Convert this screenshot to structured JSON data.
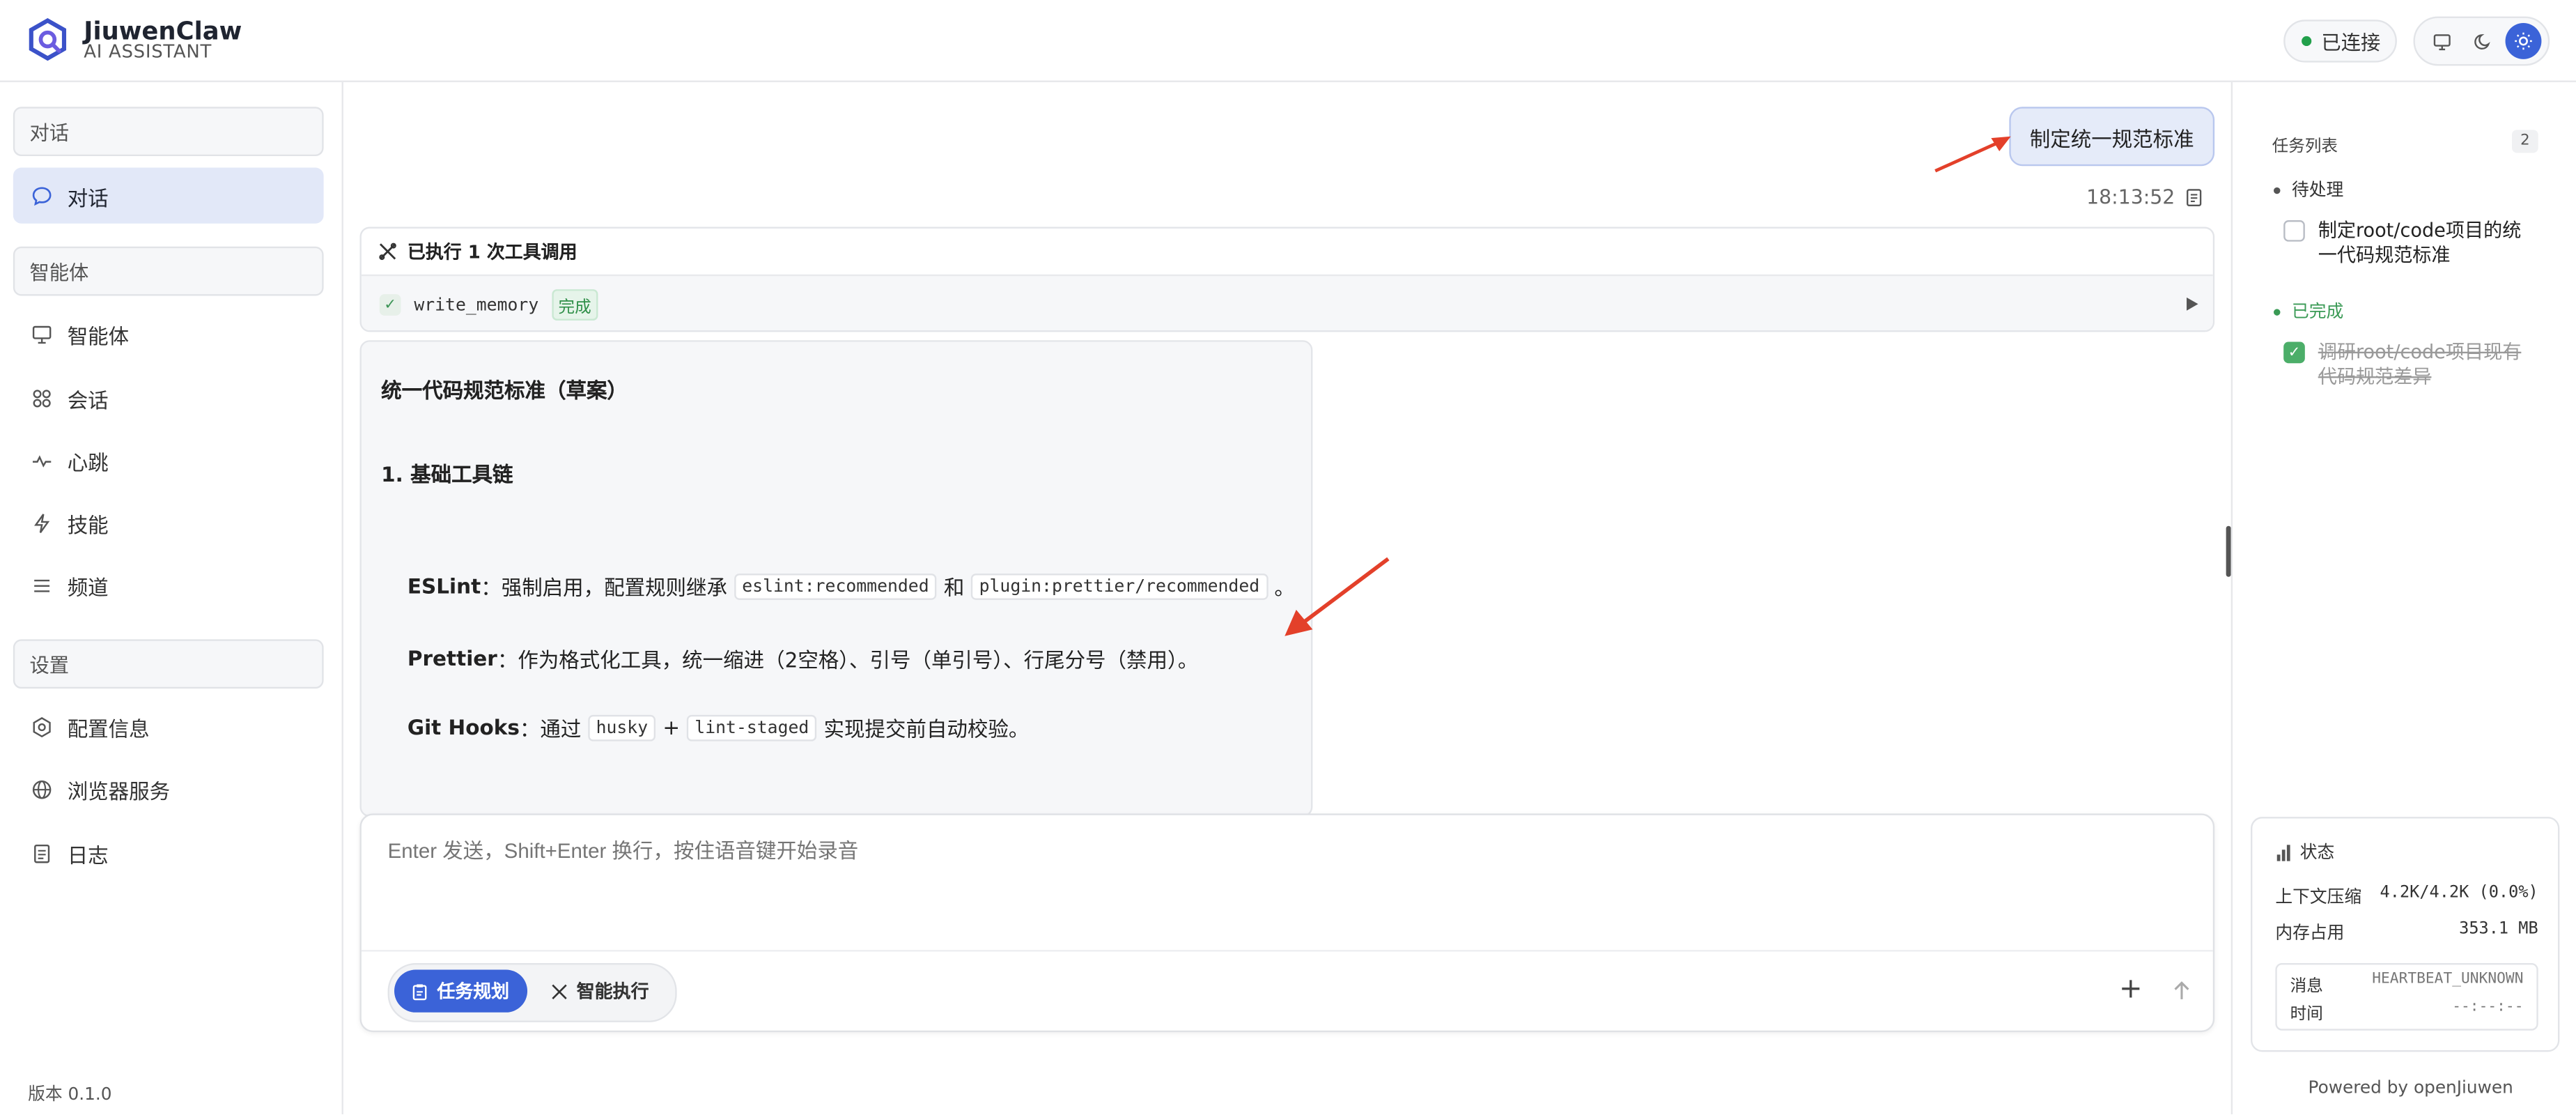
{
  "app": {
    "name": "JiuwenClaw",
    "subtitle": "AI ASSISTANT",
    "connection_status": "已连接",
    "version": "版本 0.1.0",
    "powered_by": "Powered by openJiuwen"
  },
  "theme_icons": [
    "monitor-icon",
    "moon-icon",
    "sun-icon"
  ],
  "sidebar": {
    "sections": [
      {
        "label": "对话",
        "items": [
          {
            "label": "对话",
            "icon": "chat-bubble-icon",
            "active": true
          }
        ]
      },
      {
        "label": "智能体",
        "items": [
          {
            "label": "智能体",
            "icon": "monitor-icon"
          },
          {
            "label": "会话",
            "icon": "session-icon"
          },
          {
            "label": "心跳",
            "icon": "heartbeat-icon"
          },
          {
            "label": "技能",
            "icon": "lightning-icon"
          },
          {
            "label": "频道",
            "icon": "list-icon"
          }
        ]
      },
      {
        "label": "设置",
        "items": [
          {
            "label": "配置信息",
            "icon": "gear-icon"
          },
          {
            "label": "浏览器服务",
            "icon": "globe-icon"
          },
          {
            "label": "日志",
            "icon": "document-icon"
          }
        ]
      }
    ]
  },
  "chat": {
    "user_message": "制定统一规范标准",
    "user_time": "18:13:52",
    "tool_summary": "已执行 1 次工具调用",
    "tool_call": {
      "name": "write_memory",
      "status": "完成"
    },
    "assistant": {
      "title": "统一代码规范标准（草案）",
      "section1": "1. 基础工具链",
      "eslint": {
        "label": "ESLint",
        "text1": "：强制启用，配置规则继承",
        "code1": "eslint:recommended",
        "and": "和",
        "code2": "plugin:prettier/recommended",
        "end": "。"
      },
      "prettier": {
        "label": "Prettier",
        "text": "：作为格式化工具，统一缩进（2空格）、引号（单引号）、行尾分号（禁用）。"
      },
      "githooks": {
        "label": "Git Hooks",
        "text1": "：通过",
        "code1": "husky",
        "plus": "+",
        "code2": "lint-staged",
        "text2": "实现提交前自动校验。"
      }
    }
  },
  "input": {
    "placeholder": "Enter 发送，Shift+Enter 换行，按住语音键开始录音",
    "mode_plan": "任务规划",
    "mode_exec": "智能执行"
  },
  "tasks": {
    "title": "任务列表",
    "count": "2",
    "pending_label": "待处理",
    "done_label": "已完成",
    "pending": [
      "制定root/code项目的统一代码规范标准"
    ],
    "done": [
      "调研root/code项目现有代码规范差异"
    ]
  },
  "status": {
    "title": "状态",
    "context_label": "上下文压缩",
    "context_value": "4.2K/4.2K (0.0%)",
    "memory_label": "内存占用",
    "memory_value": "353.1 MB",
    "message_label": "消息",
    "message_value": "HEARTBEAT_UNKNOWN",
    "time_label": "时间",
    "time_value": "--:--:--"
  },
  "colors": {
    "accent": "#3b63d8",
    "connected": "#22a04b",
    "done": "#4cae69",
    "annotation_arrow": "#e3402a"
  }
}
